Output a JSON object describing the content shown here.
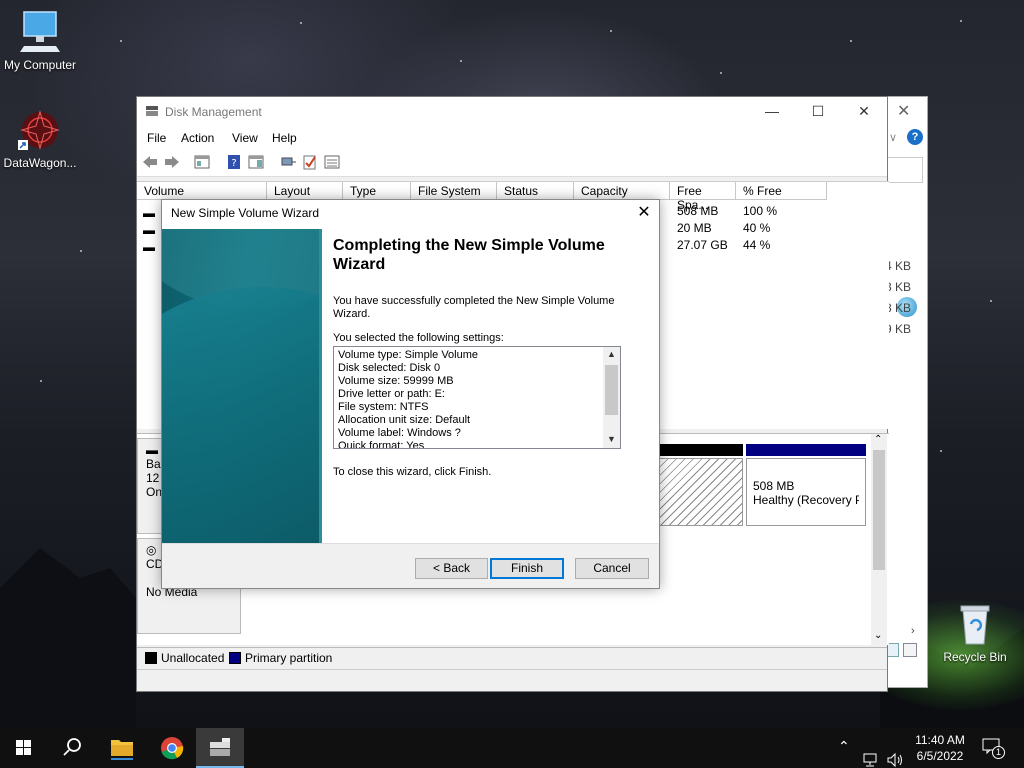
{
  "desktop": {
    "icons": [
      {
        "label": "My Computer"
      },
      {
        "label": "DataWagon..."
      },
      {
        "label": "Recycle Bin"
      }
    ]
  },
  "disk_management": {
    "title": "Disk Management",
    "menu": [
      "File",
      "Action",
      "View",
      "Help"
    ],
    "columns": [
      "Volume",
      "Layout",
      "Type",
      "File System",
      "Status",
      "Capacity",
      "Free Spa...",
      "% Free"
    ],
    "rows": [
      {
        "free_space": "508 MB",
        "pct_free": "100 %"
      },
      {
        "free_space": "20 MB",
        "pct_free": "40 %"
      },
      {
        "free_space": "27.07 GB",
        "pct_free": "44 %"
      }
    ],
    "disks": [
      {
        "label_lines": [
          "Ba",
          "12",
          "On"
        ]
      },
      {
        "label_lines": [
          "CD",
          "",
          "No Media"
        ]
      }
    ],
    "recovery_partition": {
      "size": "508 MB",
      "status": "Healthy (Recovery P"
    },
    "legend": [
      {
        "label": "Unallocated",
        "color": "#000000"
      },
      {
        "label": "Primary partition",
        "color": "#000080"
      }
    ]
  },
  "background_window": {
    "sizes": [
      "4 KB",
      "3 KB",
      "8 KB",
      "9 KB"
    ]
  },
  "wizard": {
    "title": "New Simple Volume Wizard",
    "heading": "Completing the New Simple Volume Wizard",
    "success_text": "You have successfully completed the New Simple Volume Wizard.",
    "settings_label": "You selected the following settings:",
    "settings": [
      "Volume type: Simple Volume",
      "Disk selected: Disk 0",
      "Volume size: 59999 MB",
      "Drive letter or path: E:",
      "File system: NTFS",
      "Allocation unit size: Default",
      "Volume label: Windows ?",
      "Quick format: Yes"
    ],
    "close_text": "To close this wizard, click Finish.",
    "buttons": {
      "back": "< Back",
      "finish": "Finish",
      "cancel": "Cancel"
    }
  },
  "taskbar": {
    "time": "11:40 AM",
    "date": "6/5/2022",
    "notification_count": "1"
  }
}
